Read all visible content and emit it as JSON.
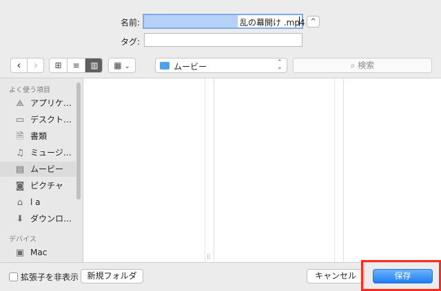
{
  "form": {
    "name_label": "名前:",
    "name_value_suffix": "乱の幕開け .mp4",
    "tag_label": "タグ:",
    "expand_glyph": "^"
  },
  "toolbar": {
    "back_glyph": "‹",
    "forward_glyph": "›",
    "view_icon_glyph": "⊞",
    "view_list_glyph": "≡",
    "view_column_glyph": "▥",
    "view_gallery_glyph": "▦",
    "gallery_chevron": "⌄",
    "location": "ムービー",
    "location_icon": "folder-icon",
    "location_chevron": "⌃⌄",
    "search_placeholder": "検索",
    "search_icon": "magnifier-icon"
  },
  "sidebar": {
    "favorites_header": "よく使う項目",
    "devices_header": "デバイス",
    "items": [
      {
        "label": "アプリケ…",
        "icon": "applications-icon",
        "glyph": "⟁"
      },
      {
        "label": "デスクト…",
        "icon": "desktop-icon",
        "glyph": "▭"
      },
      {
        "label": "書類",
        "icon": "documents-icon",
        "glyph": "🗎"
      },
      {
        "label": "ミュージ…",
        "icon": "music-icon",
        "glyph": "♫"
      },
      {
        "label": "ムービー",
        "icon": "movies-icon",
        "glyph": "▤"
      },
      {
        "label": "ピクチャ",
        "icon": "pictures-icon",
        "glyph": "◙"
      },
      {
        "label": "l         a",
        "icon": "home-icon",
        "glyph": "⌂"
      },
      {
        "label": "ダウンロ…",
        "icon": "downloads-icon",
        "glyph": "⬇"
      }
    ],
    "devices": [
      {
        "label": "Mac",
        "icon": "disk-icon",
        "glyph": "▣"
      }
    ]
  },
  "columns": {
    "resize_glyph": "||"
  },
  "footer": {
    "hide_ext_label": "拡張子を非表示",
    "hide_ext_checked": false,
    "new_folder_label": "新規フォルダ",
    "cancel_label": "キャンセル",
    "save_label": "保存"
  },
  "colors": {
    "accent": "#1d7ff4",
    "highlight_box": "#ff2a1a",
    "window_bg": "#ececec"
  }
}
